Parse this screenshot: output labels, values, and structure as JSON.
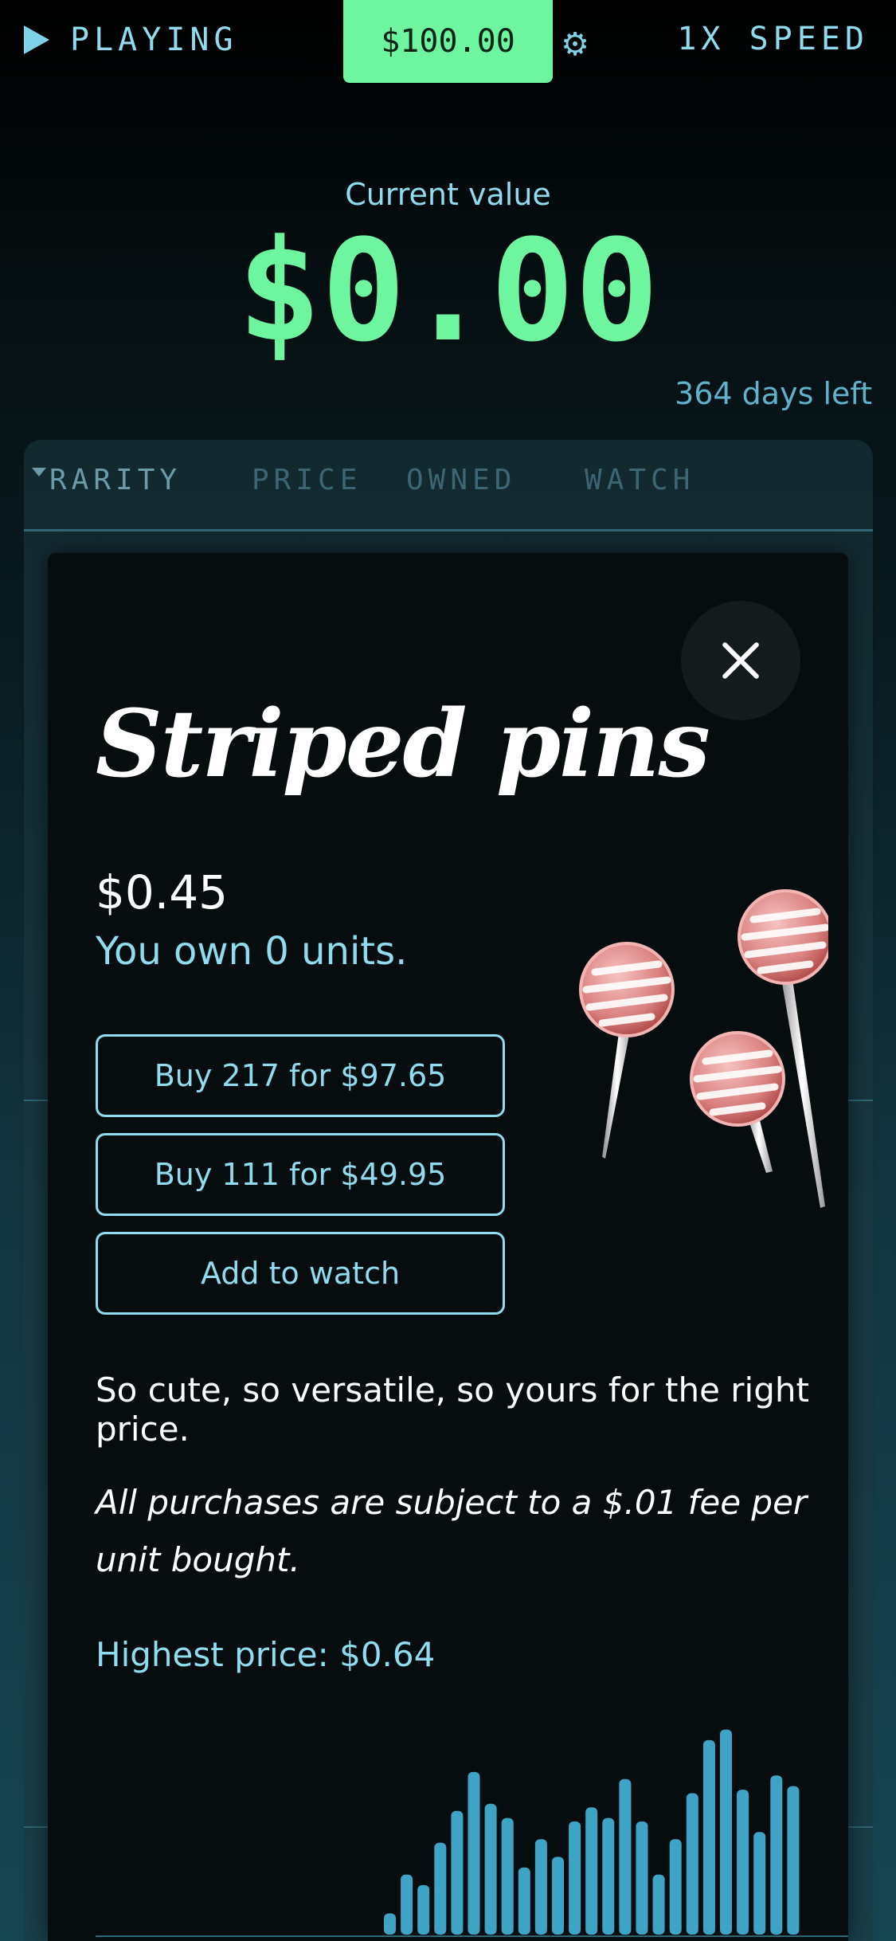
{
  "topbar": {
    "status_label": "PLAYING",
    "balance": "$100.00",
    "settings_icon": "gear-icon",
    "speed_label": "1X SPEED"
  },
  "portfolio": {
    "current_value_label": "Current value",
    "current_value": "$0.00",
    "days_left": "364 days left"
  },
  "tabs": [
    {
      "label": "RARITY",
      "active": true,
      "sort_icon": "caret-down-icon"
    },
    {
      "label": "PRICE",
      "active": false
    },
    {
      "label": "OWNED",
      "active": false
    },
    {
      "label": "WATCH",
      "active": false
    }
  ],
  "modal": {
    "close_icon": "close-icon",
    "title": "Striped pins",
    "price": "$0.45",
    "owned_text": "You own 0 units.",
    "buttons": {
      "buy_max": "Buy 217 for $97.65",
      "buy_half": "Buy 111 for $49.95",
      "watch": "Add to watch"
    },
    "illustration": "striped-pins-illustration",
    "description": "So cute, so versatile, so yours for the right price.",
    "fee_note": "All purchases are subject to a $.01 fee per unit bought.",
    "highest_price": "Highest price: $0.64"
  },
  "colors": {
    "accent_green": "#6ef5a0",
    "accent_cyan": "#8fdcef",
    "bar_blue": "#3fa3c6"
  },
  "chart_data": {
    "type": "bar",
    "title": "",
    "xlabel": "",
    "ylabel": "",
    "ylim": [
      0,
      0.64
    ],
    "values": [
      0.06,
      0.17,
      0.14,
      0.26,
      0.35,
      0.46,
      0.37,
      0.33,
      0.19,
      0.27,
      0.22,
      0.32,
      0.36,
      0.33,
      0.44,
      0.32,
      0.17,
      0.27,
      0.4,
      0.55,
      0.58,
      0.41,
      0.29,
      0.45,
      0.42
    ]
  }
}
